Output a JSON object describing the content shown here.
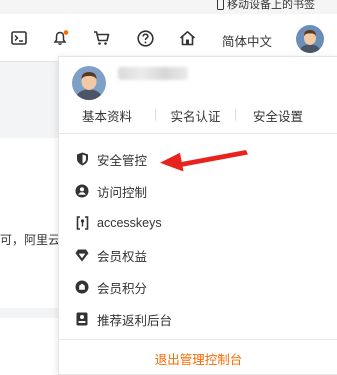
{
  "bookmark": {
    "label": "移动设备上的书签"
  },
  "header": {
    "icons": [
      "terminal-icon",
      "bell-icon",
      "cart-icon",
      "help-icon",
      "home-icon"
    ],
    "language": "简体中文",
    "notification_dot_color": "#ff6a00"
  },
  "background": {
    "partial_text": "可，阿里云"
  },
  "dropdown": {
    "tabs": [
      "基本资料",
      "实名认证",
      "安全设置"
    ],
    "items": [
      {
        "label": "安全管控",
        "icon": "shield-icon"
      },
      {
        "label": "访问控制",
        "icon": "user-circle-icon"
      },
      {
        "label": "accesskeys",
        "icon": "key-bracket-icon"
      },
      {
        "label": "会员权益",
        "icon": "diamond-icon"
      },
      {
        "label": "会员积分",
        "icon": "points-icon"
      },
      {
        "label": "推荐返利后台",
        "icon": "recommend-icon"
      }
    ],
    "footer": "退出管理控制台",
    "accent_color": "#ff6a00",
    "annotation_arrow_color": "#e8231e"
  }
}
